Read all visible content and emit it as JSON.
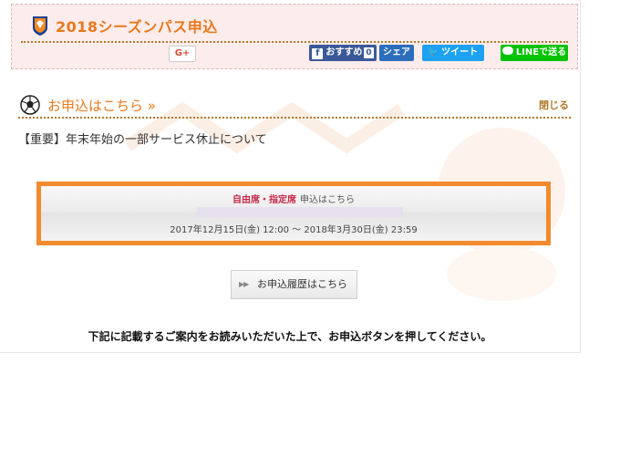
{
  "header": {
    "title": "2018シーズンパス申込"
  },
  "share": {
    "gplus_label": "G+",
    "facebook_label": "おすすめ",
    "facebook_count": "0",
    "hatena_label": "シェア",
    "twitter_label": "ツイート",
    "line_label": "LINEで送る"
  },
  "section": {
    "title": "お申込はこちら »",
    "close_label": "閉じる"
  },
  "notice": "【重要】年末年始の一部サービス休止について",
  "apply": {
    "seat_label": "自由席・指定席",
    "apply_text": "申込はこちら",
    "period": "2017年12月15日(金) 12:00 ～ 2018年3月30日(金) 23:59"
  },
  "history_button": {
    "arrow": "▶▶",
    "label": "お申込履歴はこちら"
  },
  "instruction": "下記に記載するご案内をお読みいただいた上で、お申込ボタンを押してください。",
  "colors": {
    "accent_orange": "#e8791d",
    "box_border": "#f28a2e",
    "header_bg": "#fdecec",
    "seat_label": "#c62a4a"
  }
}
